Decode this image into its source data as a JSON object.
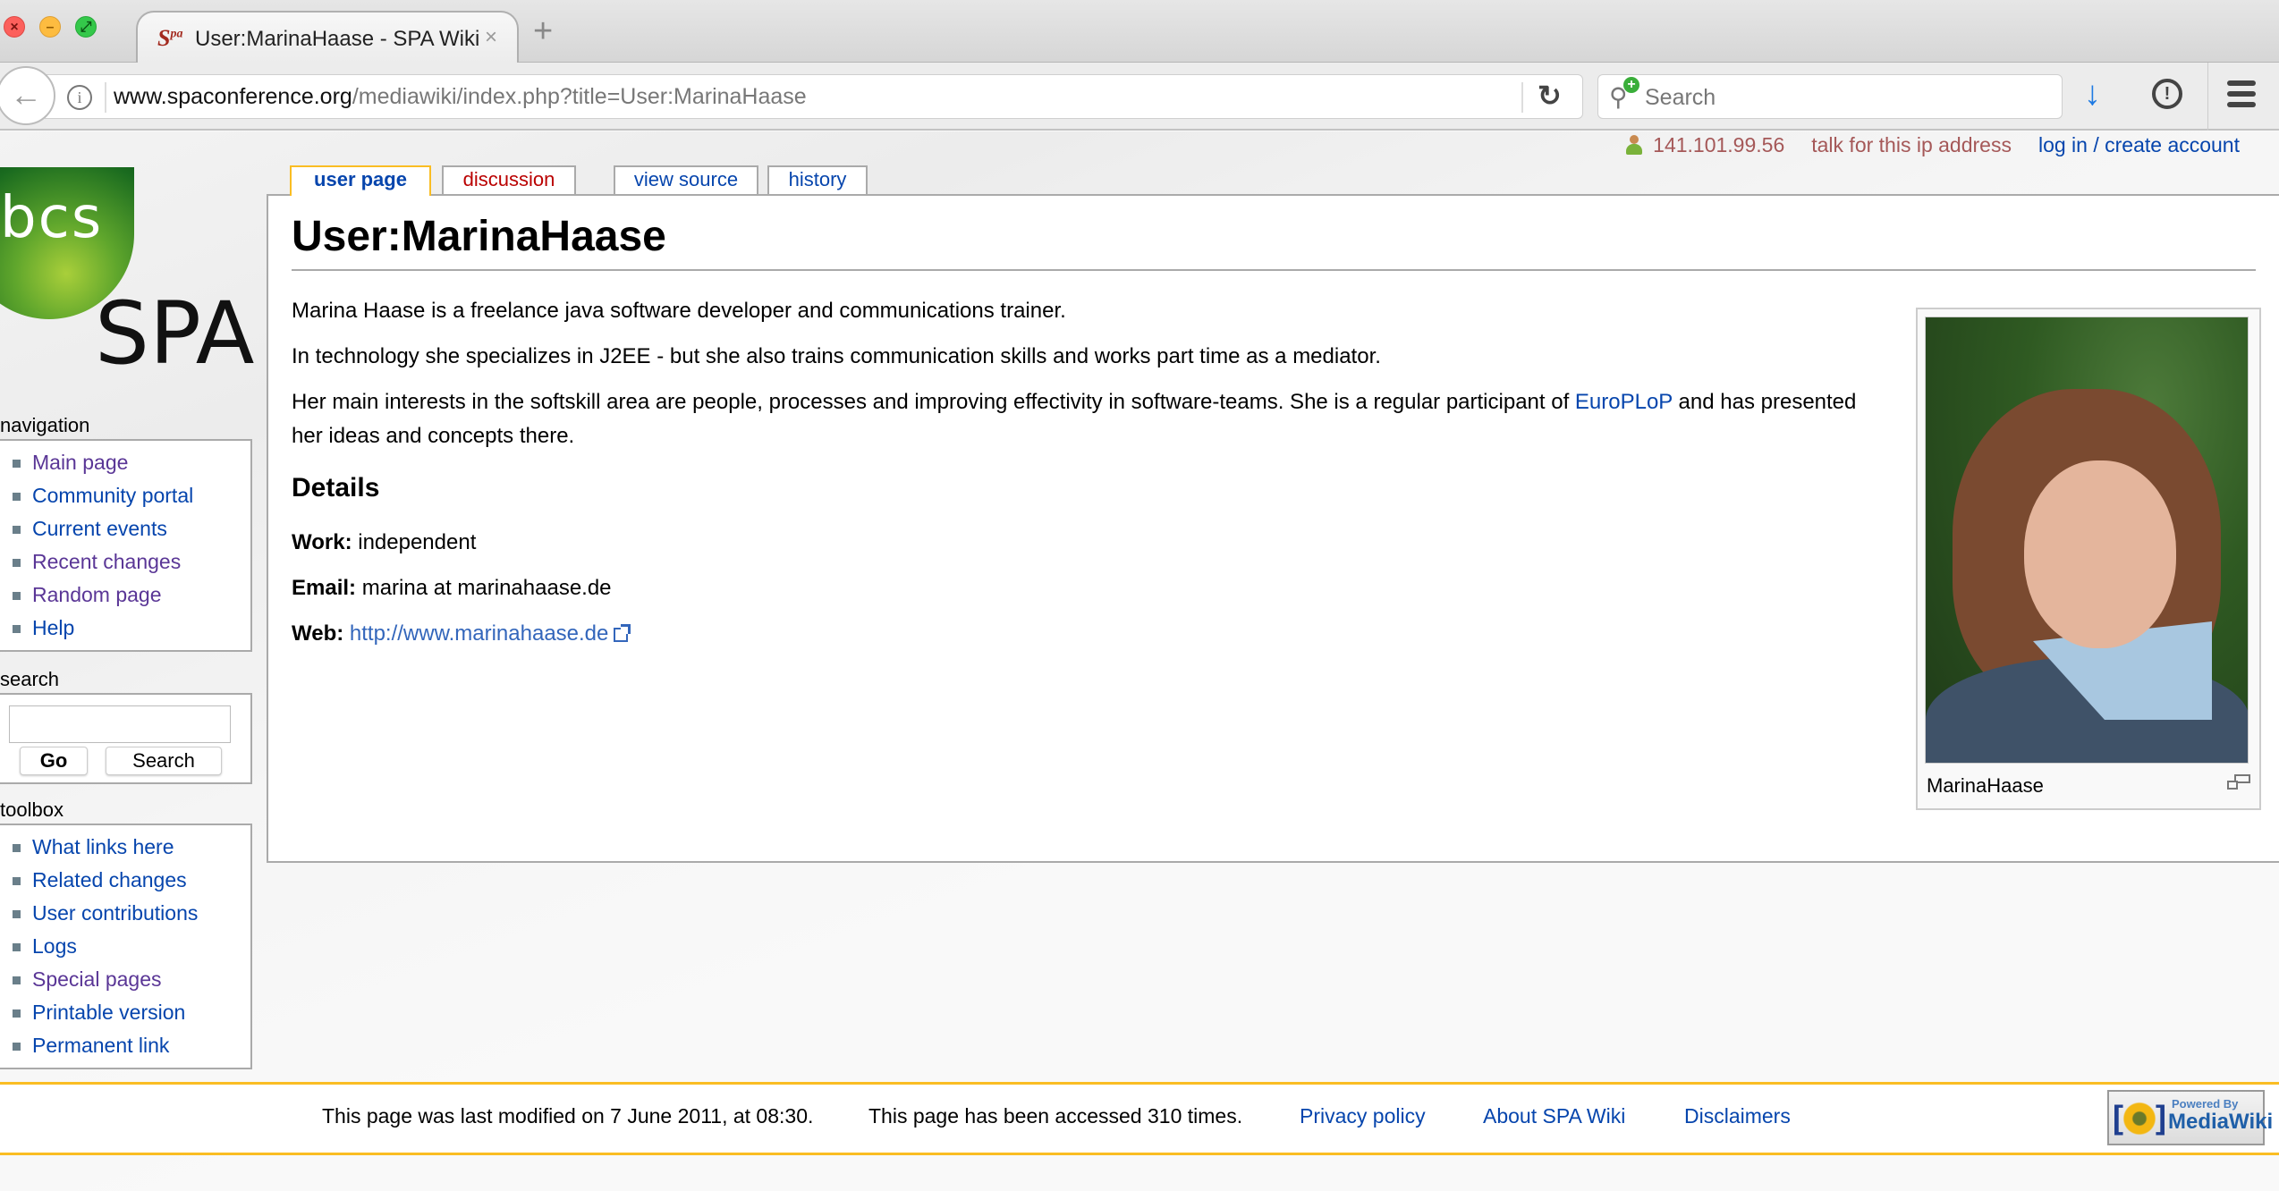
{
  "browser": {
    "tab_title": "User:MarinaHaase - SPA Wiki",
    "favicon_text": "S",
    "favicon_sup": "pa",
    "url_domain": "www.spaconference.org",
    "url_path": "/mediawiki/index.php?title=User:MarinaHaase",
    "search_placeholder": "Search",
    "icons": {
      "close": "×",
      "new_tab": "+",
      "back": "←",
      "info": "i",
      "reload": "↻",
      "search": "🔍",
      "search_plus": "+",
      "download": "↓",
      "identity": "!"
    }
  },
  "personal": {
    "ip": "141.101.99.56",
    "talk": "talk for this ip address",
    "login": "log in / create account"
  },
  "logo": {
    "top_text": "bcs",
    "bottom_text": "SPA"
  },
  "tabs": [
    {
      "label": "user page",
      "selected": true,
      "color": "#0645ad"
    },
    {
      "label": "discussion",
      "selected": false,
      "color": "#ba0000"
    },
    {
      "label": "view source",
      "selected": false,
      "color": "#0645ad"
    },
    {
      "label": "history",
      "selected": false,
      "color": "#0645ad"
    }
  ],
  "sidebar": {
    "navigation": {
      "title": "navigation",
      "items": [
        {
          "label": "Main page",
          "visited": true
        },
        {
          "label": "Community portal",
          "visited": false
        },
        {
          "label": "Current events",
          "visited": false
        },
        {
          "label": "Recent changes",
          "visited": true
        },
        {
          "label": "Random page",
          "visited": true
        },
        {
          "label": "Help",
          "visited": false
        }
      ]
    },
    "search": {
      "title": "search",
      "input_value": "",
      "go_label": "Go",
      "search_label": "Search"
    },
    "toolbox": {
      "title": "toolbox",
      "items": [
        {
          "label": "What links here",
          "visited": false
        },
        {
          "label": "Related changes",
          "visited": false
        },
        {
          "label": "User contributions",
          "visited": false
        },
        {
          "label": "Logs",
          "visited": false
        },
        {
          "label": "Special pages",
          "visited": true
        },
        {
          "label": "Printable version",
          "visited": false
        },
        {
          "label": "Permanent link",
          "visited": false
        }
      ]
    }
  },
  "article": {
    "title": "User:MarinaHaase",
    "para1": "Marina Haase is a freelance java software developer and communications trainer.",
    "para2": "In technology she specializes in J2EE - but she also trains communication skills and works part time as a mediator.",
    "para3_before": "Her main interests in the softskill area are people, processes and improving effectivity in software-teams. She is a regular participant of ",
    "para3_link": "EuroPLoP",
    "para3_after": " and has presented her ideas and concepts there.",
    "details_heading": "Details",
    "work_label": "Work:",
    "work_value": "independent",
    "email_label": "Email:",
    "email_value": "marina at marinahaase.de",
    "web_label": "Web:",
    "web_value": "http://www.marinahaase.de",
    "thumb_caption": "MarinaHaase"
  },
  "footer": {
    "last_modified": "This page was last modified on 7 June 2011, at 08:30.",
    "accessed": "This page has been accessed 310 times.",
    "privacy": "Privacy policy",
    "about": "About SPA Wiki",
    "disclaimers": "Disclaimers",
    "badge_line1": "Powered By",
    "badge_line2": "MediaWiki"
  },
  "colors": {
    "link": "#0645ad",
    "visited_link": "#5a3696",
    "new_link": "#ba0000",
    "accent_border": "#fabd23"
  }
}
